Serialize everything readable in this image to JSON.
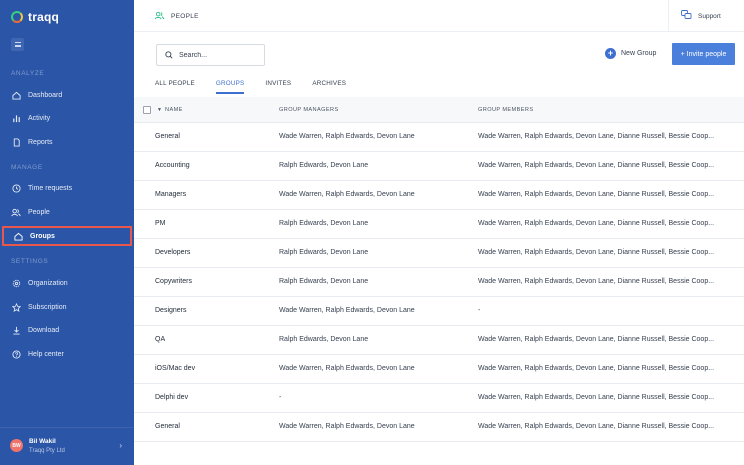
{
  "app": {
    "brand": "traqq",
    "header_title": "PEOPLE",
    "support_label": "Support"
  },
  "sidebar": {
    "sections": [
      {
        "label": "ANALYZE",
        "items": [
          {
            "label": "Dashboard",
            "icon": "home-icon"
          },
          {
            "label": "Activity",
            "icon": "bar-chart-icon"
          },
          {
            "label": "Reports",
            "icon": "document-icon"
          }
        ]
      },
      {
        "label": "MANAGE",
        "items": [
          {
            "label": "Time requests",
            "icon": "clock-icon"
          },
          {
            "label": "People",
            "icon": "people-icon"
          },
          {
            "label": "Groups",
            "icon": "home-icon",
            "active": true
          }
        ]
      },
      {
        "label": "SETTINGS",
        "items": [
          {
            "label": "Organization",
            "icon": "gear-icon"
          },
          {
            "label": "Subscription",
            "icon": "star-icon"
          },
          {
            "label": "Download",
            "icon": "download-icon"
          },
          {
            "label": "Help center",
            "icon": "help-icon"
          }
        ]
      }
    ],
    "user": {
      "initials": "BW",
      "name": "Bil Wakil",
      "org": "Traqq Pty Ltd"
    }
  },
  "toolbar": {
    "search_placeholder": "Search...",
    "new_group_label": "New Group",
    "invite_label": "+ Invite people"
  },
  "tabs": [
    {
      "label": "ALL PEOPLE",
      "active": false
    },
    {
      "label": "GROUPS",
      "active": true
    },
    {
      "label": "INVITES",
      "active": false
    },
    {
      "label": "ARCHIVES",
      "active": false
    }
  ],
  "table": {
    "columns": {
      "name": "NAME",
      "managers": "GROUP MANAGERS",
      "members": "GROUP MEMBERS"
    },
    "rows": [
      {
        "name": "General",
        "managers": "Wade Warren, Ralph Edwards, Devon Lane",
        "members": "Wade Warren, Ralph Edwards, Devon Lane, Dianne Russell, Bessie Coop..."
      },
      {
        "name": "Accounting",
        "managers": "Ralph Edwards, Devon Lane",
        "members": "Wade Warren, Ralph Edwards, Devon Lane, Dianne Russell, Bessie Coop..."
      },
      {
        "name": "Managers",
        "managers": "Wade Warren, Ralph Edwards, Devon Lane",
        "members": "Wade Warren, Ralph Edwards, Devon Lane, Dianne Russell, Bessie Coop..."
      },
      {
        "name": "PM",
        "managers": "Ralph Edwards, Devon Lane",
        "members": "Wade Warren, Ralph Edwards, Devon Lane, Dianne Russell, Bessie Coop..."
      },
      {
        "name": "Developers",
        "managers": "Ralph Edwards, Devon Lane",
        "members": "Wade Warren, Ralph Edwards, Devon Lane, Dianne Russell, Bessie Coop..."
      },
      {
        "name": "Copywriters",
        "managers": "Ralph Edwards, Devon Lane",
        "members": "Wade Warren, Ralph Edwards, Devon Lane, Dianne Russell, Bessie Coop..."
      },
      {
        "name": "Designers",
        "managers": "Wade Warren, Ralph Edwards, Devon Lane",
        "members": "-"
      },
      {
        "name": "QA",
        "managers": "Ralph Edwards, Devon Lane",
        "members": "Wade Warren, Ralph Edwards, Devon Lane, Dianne Russell, Bessie Coop..."
      },
      {
        "name": "iOS/Mac dev",
        "managers": "Wade Warren, Ralph Edwards, Devon Lane",
        "members": "Wade Warren, Ralph Edwards, Devon Lane, Dianne Russell, Bessie Coop..."
      },
      {
        "name": "Delphi dev",
        "managers": "-",
        "members": "Wade Warren, Ralph Edwards, Devon Lane, Dianne Russell, Bessie Coop..."
      },
      {
        "name": "General",
        "managers": "Wade Warren, Ralph Edwards, Devon Lane",
        "members": "Wade Warren, Ralph Edwards, Devon Lane, Dianne Russell, Bessie Coop..."
      }
    ]
  },
  "colors": {
    "sidebar_bg": "#2b55a6",
    "accent": "#3d6fd0",
    "invite_bg": "#4a7fdb",
    "active_outline": "#e8574b",
    "people_icon": "#2fbf8a"
  }
}
